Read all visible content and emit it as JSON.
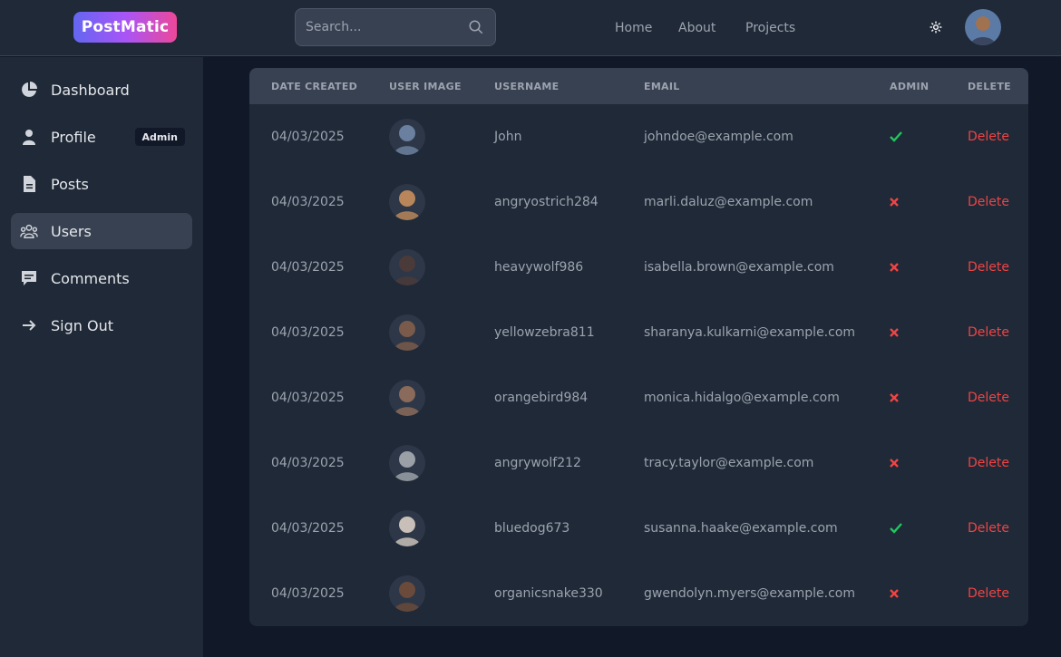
{
  "header": {
    "logo": "PostMatic",
    "search_placeholder": "Search...",
    "nav": [
      "Home",
      "About",
      "Projects"
    ],
    "theme_icon": "sun-icon"
  },
  "sidebar": {
    "items": [
      {
        "label": "Dashboard",
        "icon": "pie-chart-icon"
      },
      {
        "label": "Profile",
        "icon": "user-icon",
        "badge": "Admin"
      },
      {
        "label": "Posts",
        "icon": "document-icon"
      },
      {
        "label": "Users",
        "icon": "group-icon",
        "active": true
      },
      {
        "label": "Comments",
        "icon": "comment-icon"
      },
      {
        "label": "Sign Out",
        "icon": "arrow-right-icon"
      }
    ]
  },
  "table": {
    "headers": [
      "DATE CREATED",
      "USER IMAGE",
      "USERNAME",
      "EMAIL",
      "ADMIN",
      "DELETE"
    ],
    "rows": [
      {
        "date": "04/03/2025",
        "username": "John",
        "email": "johndoe@example.com",
        "admin": true,
        "delete": "Delete",
        "avatar_color": "#6b7f9e"
      },
      {
        "date": "04/03/2025",
        "username": "angryostrich284",
        "email": "marli.daluz@example.com",
        "admin": false,
        "delete": "Delete",
        "avatar_color": "#b8865a"
      },
      {
        "date": "04/03/2025",
        "username": "heavywolf986",
        "email": "isabella.brown@example.com",
        "admin": false,
        "delete": "Delete",
        "avatar_color": "#4a3a3a"
      },
      {
        "date": "04/03/2025",
        "username": "yellowzebra811",
        "email": "sharanya.kulkarni@example.com",
        "admin": false,
        "delete": "Delete",
        "avatar_color": "#7a5a4a"
      },
      {
        "date": "04/03/2025",
        "username": "orangebird984",
        "email": "monica.hidalgo@example.com",
        "admin": false,
        "delete": "Delete",
        "avatar_color": "#8a6a5a"
      },
      {
        "date": "04/03/2025",
        "username": "angrywolf212",
        "email": "tracy.taylor@example.com",
        "admin": false,
        "delete": "Delete",
        "avatar_color": "#9aa0a6"
      },
      {
        "date": "04/03/2025",
        "username": "bluedog673",
        "email": "susanna.haake@example.com",
        "admin": true,
        "delete": "Delete",
        "avatar_color": "#c8c0b8"
      },
      {
        "date": "04/03/2025",
        "username": "organicsnake330",
        "email": "gwendolyn.myers@example.com",
        "admin": false,
        "delete": "Delete",
        "avatar_color": "#6a4a3a"
      }
    ]
  },
  "colors": {
    "accent_gradient": [
      "#6366f1",
      "#a855f7",
      "#ec4899"
    ],
    "check": "#22c55e",
    "cross": "#ef4444",
    "delete": "#ef4444"
  }
}
